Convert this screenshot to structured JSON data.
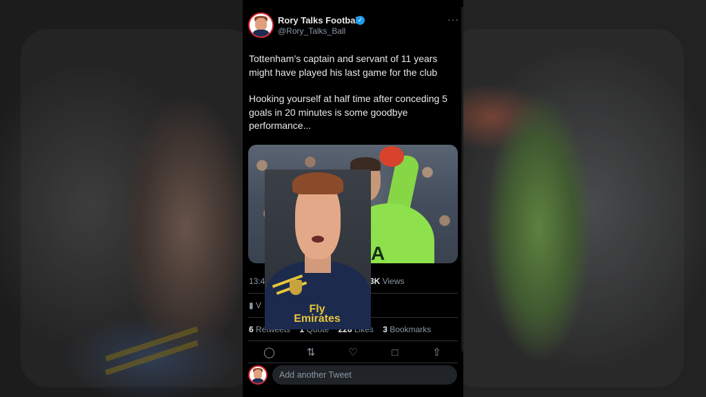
{
  "author": {
    "name": "Rory Talks Football",
    "handle": "@Rory_Talks_Ball",
    "verified": true
  },
  "tweet": {
    "paragraph1": "Tottenham’s captain and servant of 11 years might have played his last game for the club",
    "paragraph2": "Hooking yourself at half time after conceding 5 goals in 20 minutes is some goodbye performance..."
  },
  "media": {
    "keeper_sponsor": "AIA",
    "presenter_sponsor": "Fly Emirates"
  },
  "meta": {
    "time_partial": "13:4",
    "views_count_partial": "3K",
    "views_label": "Views",
    "analytics_partial": "V"
  },
  "stats": {
    "retweets_count": "6",
    "retweets_label": "Retweets",
    "quotes_count": "1",
    "quotes_label": "Quote",
    "likes_count": "226",
    "likes_label": "Likes",
    "bookmarks_count": "3",
    "bookmarks_label": "Bookmarks"
  },
  "icons": {
    "more": "more-icon",
    "reply": "reply-icon",
    "retweet": "retweet-icon",
    "like": "like-icon",
    "bookmark": "bookmark-icon",
    "share": "share-icon",
    "analytics": "analytics-icon"
  },
  "reply_box": {
    "placeholder": "Add another Tweet"
  },
  "colors": {
    "accent": "#1d9bf0",
    "background": "#000000",
    "text": "#e7e9ea",
    "muted": "#8b98a5"
  }
}
